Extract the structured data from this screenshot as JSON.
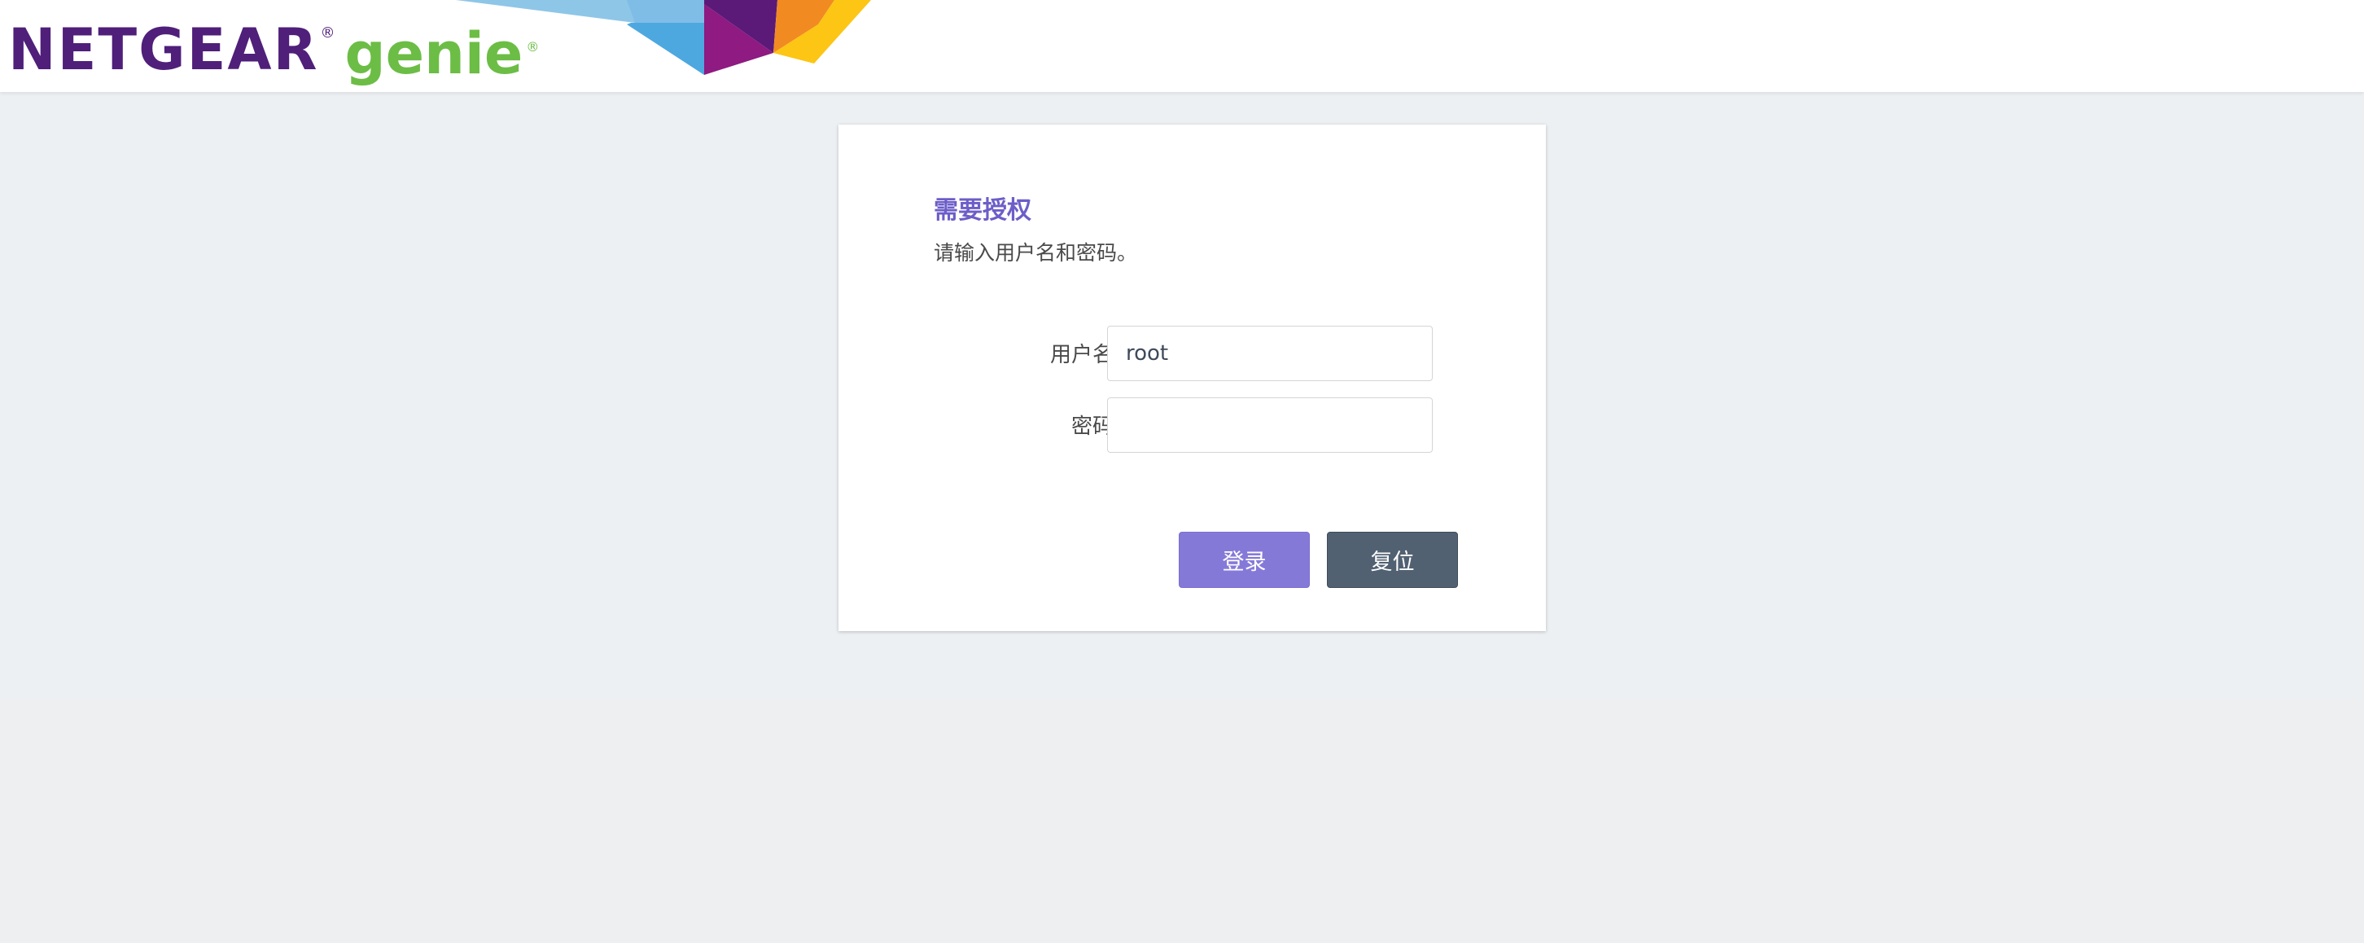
{
  "header": {
    "logo": {
      "brand": "NETGEAR",
      "product": "genie",
      "registered_mark": "®"
    }
  },
  "login": {
    "title": "需要授权",
    "subtitle": "请输入用户名和密码。",
    "username_label": "用户名",
    "username_value": "root",
    "password_label": "密码",
    "password_value": "",
    "login_button": "登录",
    "reset_button": "复位"
  },
  "colors": {
    "brand_purple": "#4f1f7a",
    "brand_green": "#6cbd45",
    "title_purple": "#6c5ec8",
    "login_button": "#8579d8",
    "reset_button": "#526172",
    "background": "#edf0f3"
  }
}
